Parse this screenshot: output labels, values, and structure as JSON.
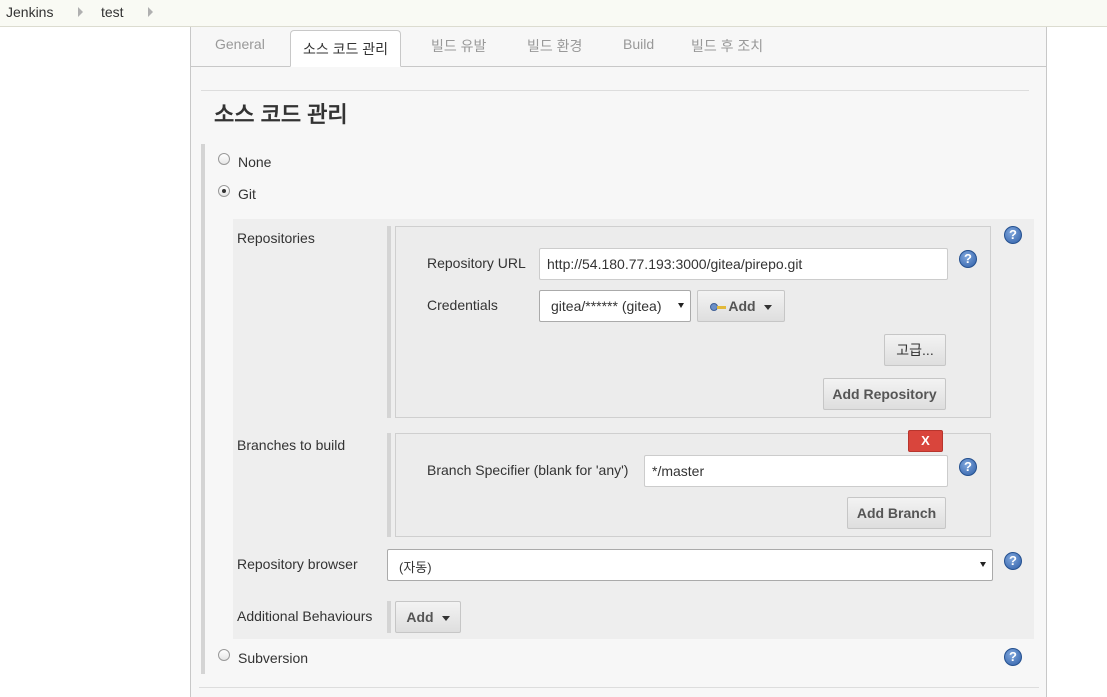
{
  "breadcrumb": {
    "items": [
      "Jenkins",
      "test"
    ]
  },
  "tabs": [
    {
      "label": "General"
    },
    {
      "label": "소스 코드 관리"
    },
    {
      "label": "빌드 유발"
    },
    {
      "label": "빌드 환경"
    },
    {
      "label": "Build"
    },
    {
      "label": "빌드 후 조치"
    }
  ],
  "active_tab": "소스 코드 관리",
  "section_title": "소스 코드 관리",
  "scm": {
    "options": [
      {
        "label": "None",
        "checked": false
      },
      {
        "label": "Git",
        "checked": true
      },
      {
        "label": "Subversion",
        "checked": false
      }
    ],
    "git": {
      "repositories_label": "Repositories",
      "repo_url_label": "Repository URL",
      "repo_url_value": "http://54.180.77.193:3000/gitea/pirepo.git",
      "credentials_label": "Credentials",
      "credentials_value": "gitea/****** (gitea)",
      "add_label": "Add",
      "advanced_label": "고급...",
      "add_repository_label": "Add Repository",
      "branches_label": "Branches to build",
      "delete_label": "X",
      "branch_specifier_label": "Branch Specifier (blank for 'any')",
      "branch_specifier_value": "*/master",
      "add_branch_label": "Add Branch",
      "repo_browser_label": "Repository browser",
      "repo_browser_value": "(자동)",
      "additional_behaviours_label": "Additional Behaviours",
      "behaviours_add_label": "Add"
    }
  },
  "help_glyph": "?",
  "icons": {
    "breadcrumb_separator": "triangle-right-icon",
    "help": "help-icon",
    "credentials": "key-icon"
  },
  "colors": {
    "help_blue": "#2f5fa8",
    "delete_red": "#d9453c",
    "crumb_bg": "#f9faf4"
  }
}
